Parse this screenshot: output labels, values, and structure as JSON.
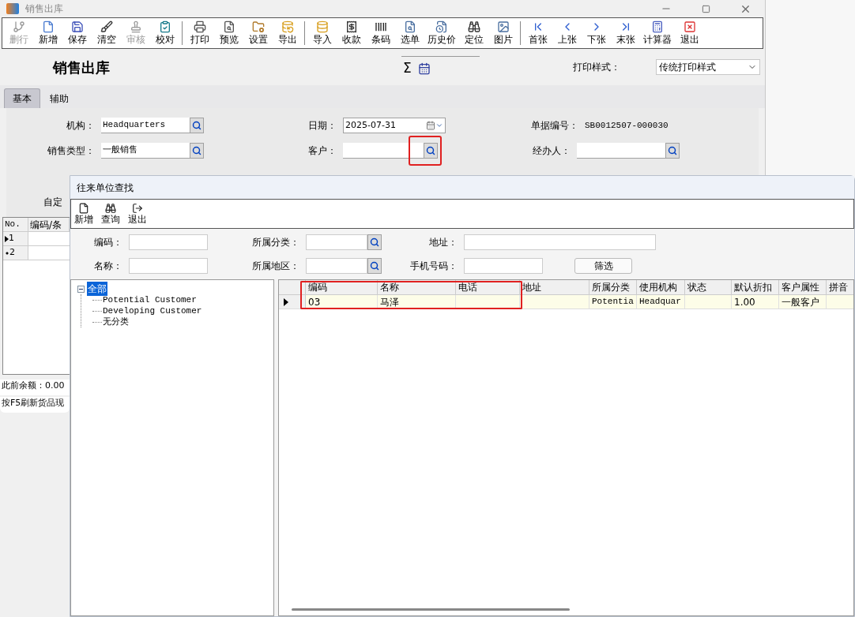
{
  "window": {
    "title": "销售出库"
  },
  "toolbar": {
    "groups": [
      [
        {
          "label": "删行",
          "disabled": true
        },
        {
          "label": "新增",
          "disabled": false
        },
        {
          "label": "保存",
          "disabled": false
        },
        {
          "label": "清空",
          "disabled": false
        },
        {
          "label": "审核",
          "disabled": true
        },
        {
          "label": "校对",
          "disabled": false
        }
      ],
      [
        {
          "label": "打印",
          "disabled": false
        },
        {
          "label": "预览",
          "disabled": false
        },
        {
          "label": "设置",
          "disabled": false
        },
        {
          "label": "导出",
          "disabled": false
        }
      ],
      [
        {
          "label": "导入",
          "disabled": false
        },
        {
          "label": "收款",
          "disabled": false
        },
        {
          "label": "条码",
          "disabled": false
        },
        {
          "label": "选单",
          "disabled": false
        },
        {
          "label": "历史价",
          "disabled": false
        },
        {
          "label": "定位",
          "disabled": false
        },
        {
          "label": "图片",
          "disabled": false
        }
      ],
      [
        {
          "label": "首张",
          "disabled": false
        },
        {
          "label": "上张",
          "disabled": false
        },
        {
          "label": "下张",
          "disabled": false
        },
        {
          "label": "末张",
          "disabled": false
        },
        {
          "label": "计算器",
          "disabled": false
        },
        {
          "label": "退出",
          "disabled": false
        }
      ]
    ]
  },
  "header": {
    "title": "销售出库",
    "sigma": "Σ",
    "print_style": {
      "label": "打印样式：",
      "value": "传统打印样式"
    }
  },
  "tabs": [
    {
      "label": "基本",
      "selected": true
    },
    {
      "label": "辅助",
      "selected": false
    }
  ],
  "form": {
    "rows": [
      [
        {
          "label": "机构：",
          "value": "Headquarters",
          "kind": "lookup",
          "highlighted": false
        },
        {
          "label": "日期：",
          "value": "2025-07-31",
          "kind": "date",
          "highlighted": false
        },
        {
          "label": "单据编号：",
          "value": "SB0012507-000030",
          "kind": "text",
          "highlighted": false
        }
      ],
      [
        {
          "label": "销售类型：",
          "value": "一般销售",
          "kind": "lookup",
          "highlighted": false
        },
        {
          "label": "客户：",
          "kind": "lookup",
          "highlighted": true
        },
        {
          "label": "经办人：",
          "kind": "lookup",
          "highlighted": false
        }
      ]
    ],
    "partial_label": "自定"
  },
  "items_grid": {
    "columns": [
      "No.",
      "编码/条"
    ],
    "rows": [
      {
        "number": "1",
        "kind": "current"
      },
      {
        "number": "2",
        "kind": "new"
      }
    ]
  },
  "footer": {
    "balance": "此前余额：0.00",
    "hint": "按F5刷新货品现"
  },
  "dialog": {
    "title": "往来单位查找",
    "toolbar": [
      {
        "label": "新增"
      },
      {
        "label": "查询"
      },
      {
        "label": "退出"
      }
    ],
    "filters": [
      [
        {
          "label": "编码：",
          "kind": "text"
        },
        {
          "label": "所属分类：",
          "kind": "lookup"
        },
        {
          "label": "地址：",
          "kind": "wide"
        }
      ],
      [
        {
          "label": "名称：",
          "kind": "text"
        },
        {
          "label": "所属地区：",
          "kind": "lookup"
        },
        {
          "label": "手机号码：",
          "kind": "text"
        }
      ]
    ],
    "filter_button": "筛选",
    "tree": [
      {
        "label": "全部",
        "selected": true,
        "expanded": true,
        "children": [
          {
            "label": "Potential Customer",
            "selected": false
          },
          {
            "label": "Developing Customer",
            "selected": false
          },
          {
            "label": "无分类",
            "selected": false
          }
        ]
      }
    ],
    "table": {
      "columns": [
        {
          "label": "编码",
          "highlighted": true
        },
        {
          "label": "名称",
          "highlighted": true
        },
        {
          "label": "电话",
          "highlighted": true
        },
        {
          "label": "地址",
          "highlighted": false
        },
        {
          "label": "所属分类",
          "highlighted": false
        },
        {
          "label": "使用机构",
          "highlighted": false
        },
        {
          "label": "状态",
          "highlighted": false
        },
        {
          "label": "默认折扣",
          "highlighted": false
        },
        {
          "label": "客户属性",
          "highlighted": false
        },
        {
          "label": "拼音",
          "highlighted": false
        }
      ],
      "rows": [
        {
          "selected": true,
          "cells": [
            {
              "text": "03"
            },
            {
              "text": "马泽"
            },
            {},
            {},
            {
              "text": "Potentia",
              "kind": "mono"
            },
            {
              "text": "Headquar",
              "kind": "mono"
            },
            {},
            {
              "text": "1.00"
            },
            {
              "text": "一般客户"
            },
            {}
          ]
        }
      ]
    }
  }
}
